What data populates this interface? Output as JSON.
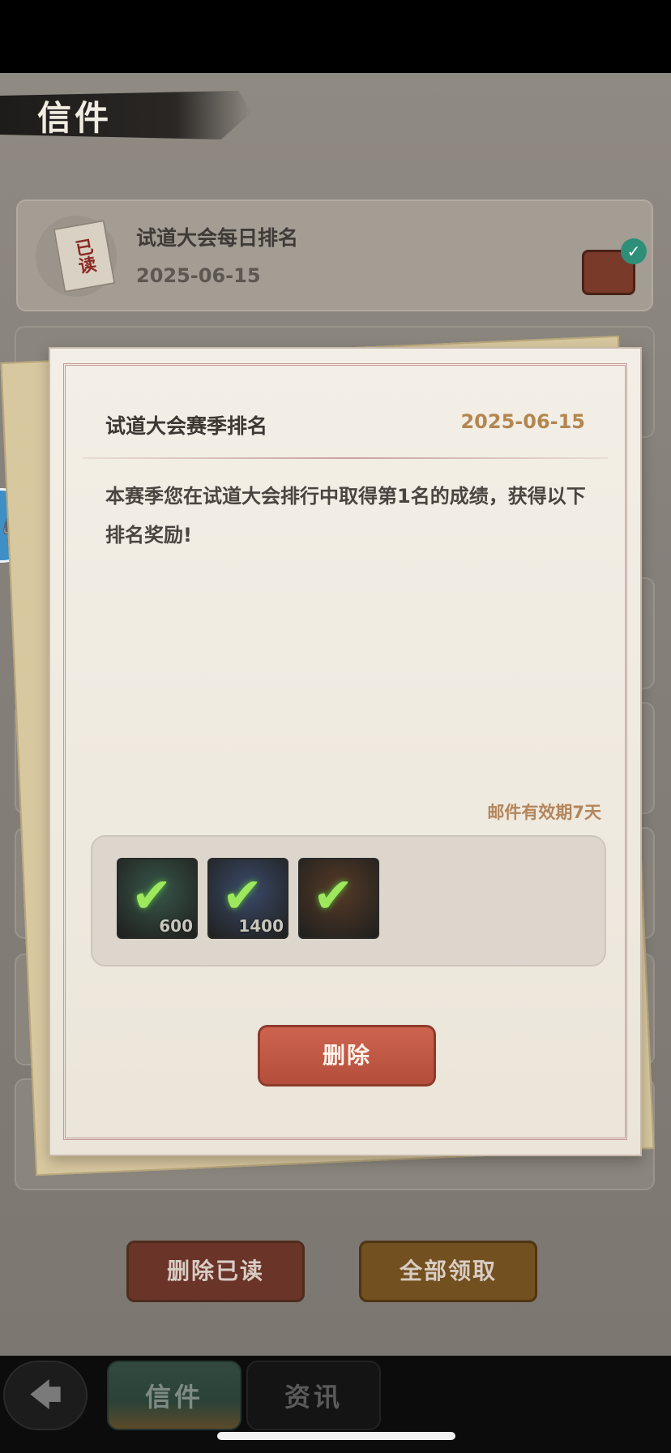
{
  "header": {
    "title": "信件"
  },
  "mail_list": {
    "items": [
      {
        "badge": "已读",
        "title": "试道大会每日排名",
        "date": "2025-06-15"
      }
    ]
  },
  "letter": {
    "title": "试道大会赛季排名",
    "date": "2025-06-15",
    "body": "本赛季您在试道大会排行中取得第1名的成绩，获得以下排名奖励!",
    "validity": "邮件有效期7天",
    "rewards": [
      {
        "count": "600",
        "claimed": true,
        "color": "#37564a"
      },
      {
        "count": "1400",
        "claimed": true,
        "color": "#3b4a6a"
      },
      {
        "count": "",
        "claimed": true,
        "color": "#553a27"
      }
    ],
    "delete_label": "删除"
  },
  "actions": {
    "delete_read_label": "删除已读",
    "claim_all_label": "全部领取"
  },
  "nav": {
    "back_icon": "arrow-left-icon",
    "tabs": [
      {
        "label": "信件",
        "active": true
      },
      {
        "label": "资讯",
        "active": false
      }
    ]
  }
}
